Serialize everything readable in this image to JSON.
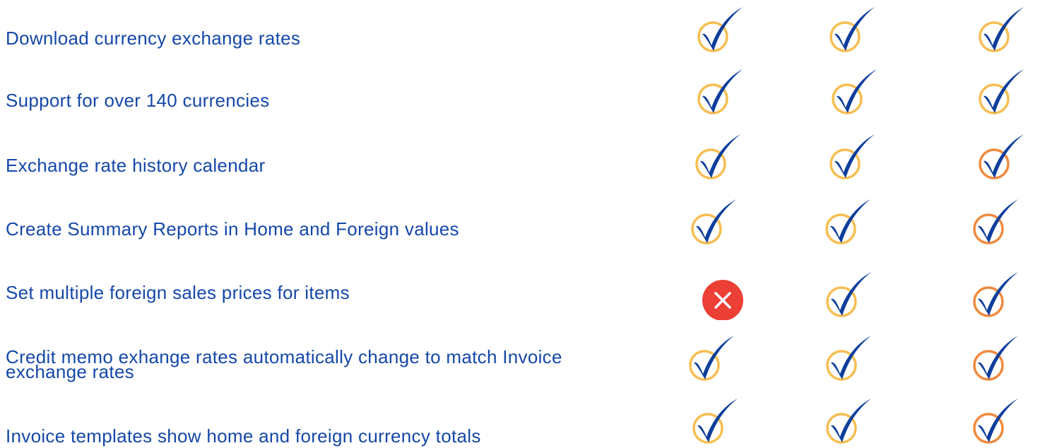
{
  "colors": {
    "text": "#1548a8",
    "check_stroke": "#0d3e9c",
    "ring_yellow": "#f6be52",
    "ring_orange": "#ef8a3f",
    "x_fill": "#ec3f35"
  },
  "rows": [
    {
      "label": "Download currency exchange rates",
      "marks": [
        {
          "icon": "check-icon",
          "ring": "yellow"
        },
        {
          "icon": "check-icon",
          "ring": "yellow"
        },
        {
          "icon": "check-icon",
          "ring": "yellow"
        }
      ]
    },
    {
      "label": "Support for over 140 currencies",
      "marks": [
        {
          "icon": "check-icon",
          "ring": "yellow"
        },
        {
          "icon": "check-icon",
          "ring": "yellow"
        },
        {
          "icon": "check-icon",
          "ring": "yellow"
        }
      ]
    },
    {
      "label": "Exchange rate history calendar",
      "marks": [
        {
          "icon": "check-icon",
          "ring": "yellow"
        },
        {
          "icon": "check-icon",
          "ring": "yellow"
        },
        {
          "icon": "check-icon",
          "ring": "orange"
        }
      ]
    },
    {
      "label": "Create Summary Reports in Home and Foreign values",
      "marks": [
        {
          "icon": "check-icon",
          "ring": "yellow"
        },
        {
          "icon": "check-icon",
          "ring": "yellow"
        },
        {
          "icon": "check-icon",
          "ring": "orange"
        }
      ]
    },
    {
      "label": "Set multiple foreign sales prices for items",
      "marks": [
        {
          "icon": "x-icon",
          "ring": "none"
        },
        {
          "icon": "check-icon",
          "ring": "yellow"
        },
        {
          "icon": "check-icon",
          "ring": "orange"
        }
      ]
    },
    {
      "label": "Credit memo exhange rates automatically change to match Invoice",
      "label2": "exchange rates",
      "marks": [
        {
          "icon": "check-icon",
          "ring": "yellow"
        },
        {
          "icon": "check-icon",
          "ring": "yellow"
        },
        {
          "icon": "check-icon",
          "ring": "orange"
        }
      ]
    },
    {
      "label": "Invoice templates show home and foreign currency totals",
      "marks": [
        {
          "icon": "check-icon",
          "ring": "yellow"
        },
        {
          "icon": "check-icon",
          "ring": "yellow"
        },
        {
          "icon": "check-icon",
          "ring": "orange"
        }
      ]
    }
  ]
}
